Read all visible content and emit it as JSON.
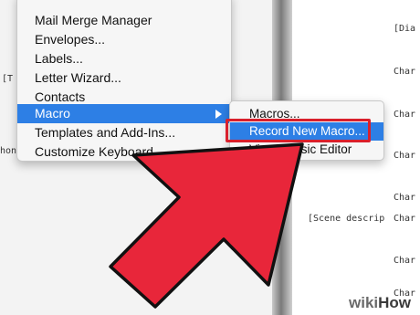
{
  "menu": {
    "items": [
      {
        "label": "Mail Merge Manager"
      },
      {
        "label": "Envelopes..."
      },
      {
        "label": "Labels..."
      },
      {
        "label": "Letter Wizard..."
      },
      {
        "label": "Contacts"
      },
      {
        "label": "Macro"
      },
      {
        "label": "Templates and Add-Ins..."
      },
      {
        "label": "Customize Keyboard..."
      }
    ]
  },
  "submenu": {
    "items": [
      {
        "label": "Macros..."
      },
      {
        "label": "Record New Macro..."
      },
      {
        "label": "Visual Basic Editor"
      }
    ]
  },
  "document": {
    "lines": [
      "[Dia",
      "Char",
      "Char",
      "Char",
      "Char",
      "Char",
      "[Scene descrip",
      "Char",
      "Char"
    ],
    "left_fragments": [
      "[T",
      "hon"
    ]
  },
  "watermark": {
    "wiki": "wiki",
    "how": "How"
  },
  "colors": {
    "selection": "#2d7fe5",
    "arrow": "#e8263a",
    "highlight_border": "#d9202c"
  }
}
